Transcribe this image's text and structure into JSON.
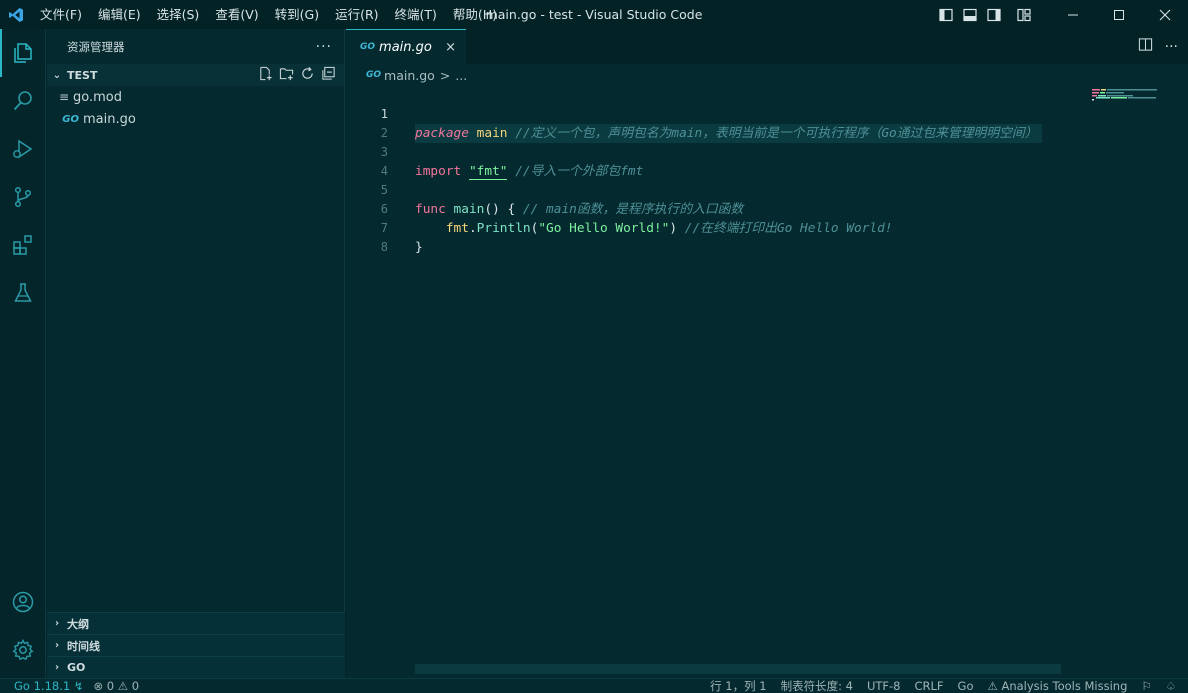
{
  "titlebar": {
    "menu": [
      "文件(F)",
      "编辑(E)",
      "选择(S)",
      "查看(V)",
      "转到(G)",
      "运行(R)",
      "终端(T)",
      "帮助(H)"
    ],
    "window_title": "main.go - test - Visual Studio Code"
  },
  "sidebar": {
    "title": "资源管理器",
    "more": "···",
    "folder": "TEST",
    "files": [
      {
        "name": "go.mod",
        "icon": "list-icon"
      },
      {
        "name": "main.go",
        "icon": "go-icon"
      }
    ],
    "bottom_sections": [
      "大纲",
      "时间线",
      "GO"
    ]
  },
  "editor": {
    "tab": {
      "name": "main.go",
      "close": "×",
      "icon_text": "GO"
    },
    "breadcrumb": {
      "file": "main.go",
      "sep": ">",
      "more": "..."
    },
    "line_numbers": [
      "1",
      "2",
      "3",
      "4",
      "5",
      "6",
      "7",
      "8"
    ],
    "code": {
      "l1_kw": "package",
      "l1_name": "main",
      "l1_comment": "//定义一个包，声明包名为main，表明当前是一个可执行程序（Go通过包来管理明明空间）",
      "l3_kw": "import",
      "l3_str": "\"fmt\"",
      "l3_comment": "//导入一个外部包fmt",
      "l5_kw": "func",
      "l5_fn": "main",
      "l5_rest": "() {",
      "l5_comment": "// main函数，是程序执行的入口函数",
      "l6_pkg": "fmt",
      "l6_dot": ".",
      "l6_fn": "Println",
      "l6_open": "(",
      "l6_str": "\"Go Hello World!\"",
      "l6_close": ")",
      "l6_comment": "//在终端打印出Go Hello World!",
      "l7": "}"
    }
  },
  "status": {
    "go_version": "Go 1.18.1",
    "errors": "0",
    "warnings": "0",
    "position": "行 1，列 1",
    "tab_size": "制表符长度: 4",
    "encoding": "UTF-8",
    "eol": "CRLF",
    "language": "Go",
    "analysis": "Analysis Tools Missing"
  },
  "colors": {
    "accent": "#2bb7c6",
    "background": "#042a2f",
    "keyword": "#f3759b",
    "string": "#7ff0a0",
    "comment": "#4e8f96"
  }
}
